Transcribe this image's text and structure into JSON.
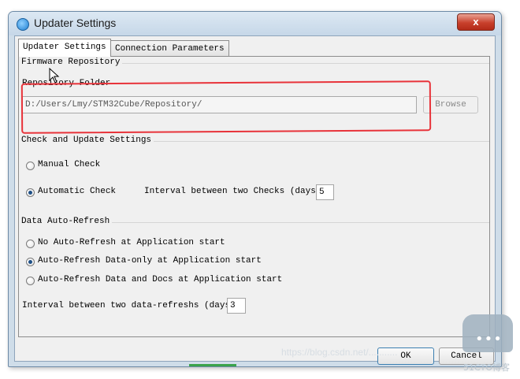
{
  "window": {
    "title": "Updater Settings",
    "close_label": "x"
  },
  "tabs": [
    {
      "label": "Updater Settings"
    },
    {
      "label": "Connection Parameters"
    }
  ],
  "firmware_repository": {
    "group_title": "Firmware Repository",
    "folder_label": "Repository Folder",
    "folder_value": "D:/Users/Lmy/STM32Cube/Repository/",
    "browse_label": "Browse"
  },
  "check_update": {
    "group_title": "Check and Update Settings",
    "manual_label": "Manual Check",
    "automatic_label": "Automatic Check",
    "interval_label": "Interval between two Checks (days)",
    "interval_value": "5",
    "selected": "automatic"
  },
  "data_refresh": {
    "group_title": "Data Auto-Refresh",
    "options": [
      {
        "label": "No Auto-Refresh at Application start",
        "checked": false
      },
      {
        "label": "Auto-Refresh Data-only at Application start",
        "checked": true
      },
      {
        "label": "Auto-Refresh Data and Docs at Application start",
        "checked": false
      }
    ],
    "interval_label": "Interval between two data-refreshs (days)",
    "interval_value": "3"
  },
  "footer": {
    "ok_label": "OK",
    "cancel_label": "Cancel"
  },
  "overlay": {
    "watermark_url": "https://blog.csdn.net/...........",
    "watermark_dots": "•••",
    "watermark_site": "51CTO博客",
    "annotation_color": "#e8333a"
  }
}
